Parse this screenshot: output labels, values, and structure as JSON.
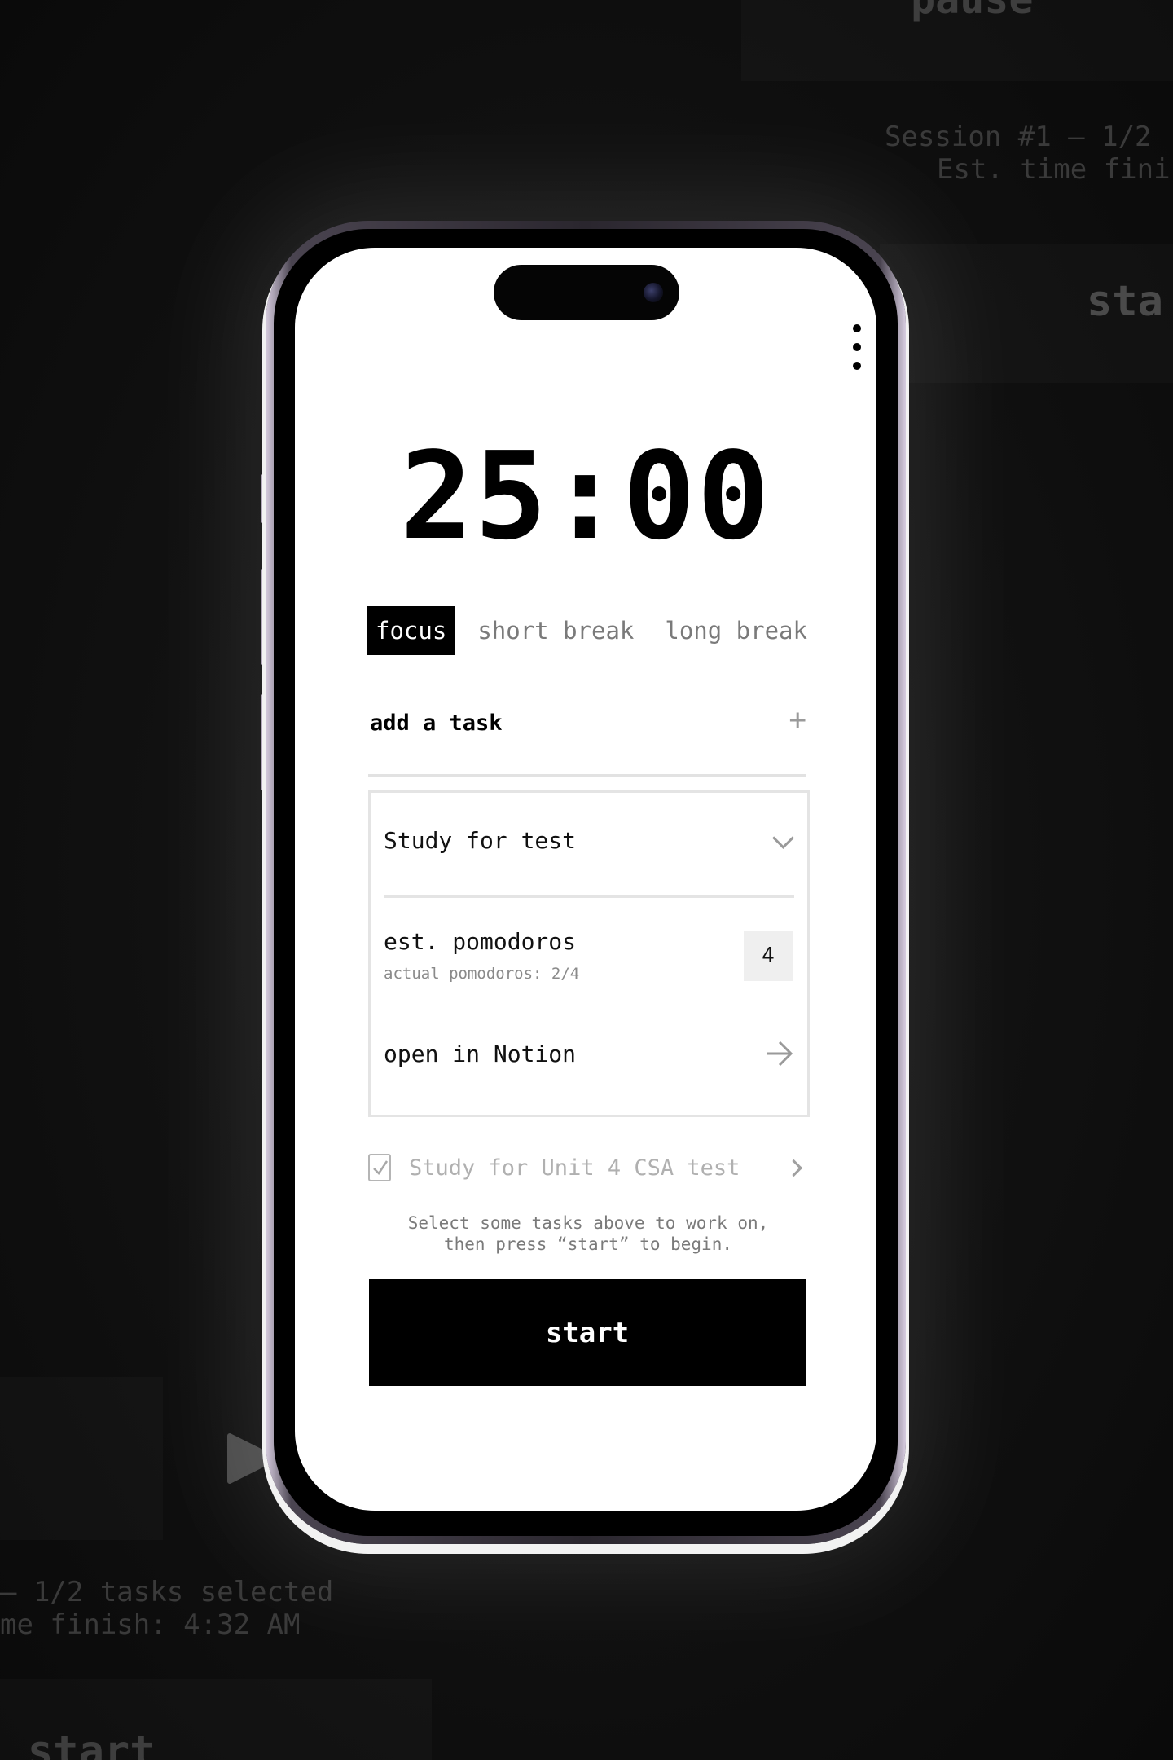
{
  "background": {
    "top_pause_label": "pause",
    "top_session_line1": "Session #1 — 1/2",
    "top_session_line2": "Est. time fini",
    "top_start_label": "sta",
    "bottom_session_line1": "— 1/2 tasks selected",
    "bottom_session_line2": "me finish: 4:32 AM",
    "bottom_start_label": "start",
    "play_icon": "play-icon"
  },
  "app": {
    "menu_icon": "more-vertical-icon",
    "timer": "25:00",
    "modes": [
      {
        "label": "focus",
        "active": true
      },
      {
        "label": "short break",
        "active": false
      },
      {
        "label": "long break",
        "active": false
      }
    ],
    "add_task": {
      "label": "add a task",
      "icon": "plus-icon",
      "icon_glyph": "+"
    },
    "task_editor": {
      "name": "Study for test",
      "name_chevron": "chevron-down-icon",
      "est_label": "est. pomodoros",
      "actual_label": "actual pomodoros: 2/4",
      "est_value": "4",
      "notion_label": "open in Notion",
      "notion_icon": "arrow-right-icon"
    },
    "selected_task": {
      "label": "Study for Unit 4 CSA test",
      "checked": true,
      "chevron": "chevron-right-icon"
    },
    "hint_line1": "Select some tasks above to work on,",
    "hint_line2": "then press “start” to begin.",
    "start_label": "start"
  },
  "colors": {
    "accent": "#000000",
    "screen_background": "#ffffff",
    "muted_text": "#7a7a7a",
    "page_background": "#0c0c0c"
  }
}
